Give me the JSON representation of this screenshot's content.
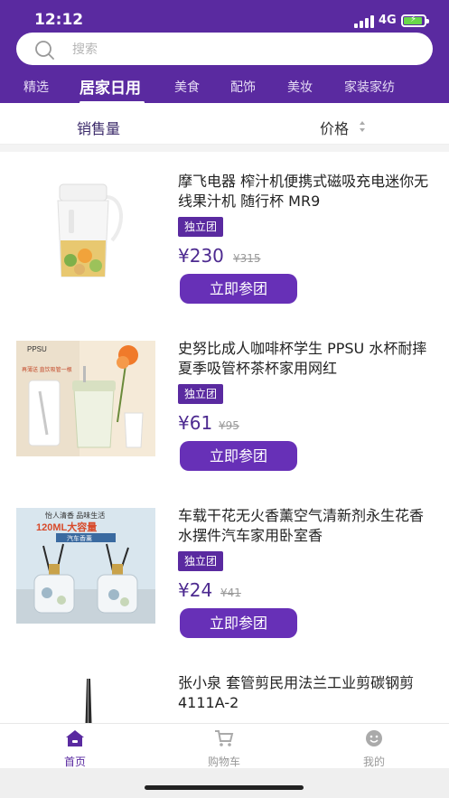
{
  "status_bar": {
    "time": "12:12",
    "network": "4G"
  },
  "search": {
    "placeholder": "搜索"
  },
  "tabs": [
    {
      "label": "精选"
    },
    {
      "label": "居家日用",
      "active": true
    },
    {
      "label": "美食"
    },
    {
      "label": "配饰"
    },
    {
      "label": "美妆"
    },
    {
      "label": "家装家纺"
    }
  ],
  "sort": {
    "sales_label": "销售量",
    "price_label": "价格"
  },
  "products": [
    {
      "title": "摩飞电器 榨汁机便携式磁吸充电迷你无线果汁机 随行杯 MR9",
      "badge": "独立团",
      "price": "¥230",
      "original_price": "¥315",
      "button": "立即参团",
      "image": "juicer-cup"
    },
    {
      "title": "史努比成人咖啡杯学生 PPSU 水杯耐摔夏季吸管杯茶杯家用网红",
      "badge": "独立团",
      "price": "¥61",
      "original_price": "¥95",
      "button": "立即参团",
      "image": "ppsu-cup",
      "image_text": {
        "brand": "PPSU",
        "note": "再薄送 直饮吸管一根"
      }
    },
    {
      "title": "车载干花无火香薰空气清新剂永生花香水摆件汽车家用卧室香",
      "badge": "独立团",
      "price": "¥24",
      "original_price": "¥41",
      "button": "立即参团",
      "image": "aroma-diffuser",
      "image_text": {
        "top": "怡人清香 品味生活",
        "capacity": "120ML大容量",
        "ribbon": "汽车香薰"
      }
    },
    {
      "title": "张小泉 套管剪民用法兰工业剪碳钢剪 4111A-2",
      "image": "scissors"
    }
  ],
  "bottom_nav": [
    {
      "label": "首页",
      "icon": "home-icon",
      "active": true
    },
    {
      "label": "购物车",
      "icon": "cart-icon"
    },
    {
      "label": "我的",
      "icon": "smiley-icon"
    }
  ],
  "colors": {
    "primary": "#5a2aa0",
    "button": "#6730b7",
    "price": "#4d2a90"
  }
}
